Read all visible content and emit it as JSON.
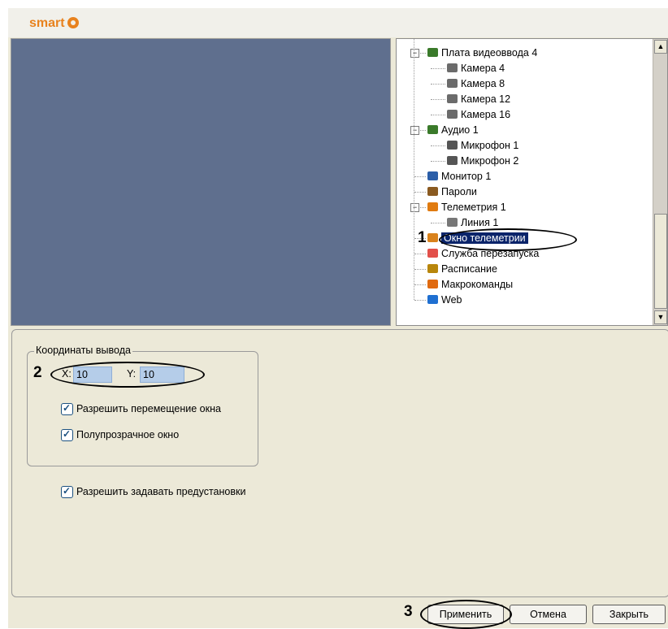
{
  "app": {
    "logo_text": "smart"
  },
  "tree": {
    "items": [
      {
        "label": "Плата видеоввода 4",
        "icon": "capture-card-icon",
        "level": 0,
        "expander": "⊟"
      },
      {
        "label": "Камера 4",
        "icon": "camera-icon",
        "level": 1
      },
      {
        "label": "Камера 8",
        "icon": "camera-icon",
        "level": 1
      },
      {
        "label": "Камера 12",
        "icon": "camera-icon",
        "level": 1
      },
      {
        "label": "Камера 16",
        "icon": "camera-icon",
        "level": 1
      },
      {
        "label": "Аудио 1",
        "icon": "audio-card-icon",
        "level": 0,
        "expander": "⊟"
      },
      {
        "label": "Микрофон 1",
        "icon": "microphone-icon",
        "level": 1
      },
      {
        "label": "Микрофон 2",
        "icon": "microphone-icon",
        "level": 1
      },
      {
        "label": "Монитор 1",
        "icon": "monitor-icon",
        "level": 0
      },
      {
        "label": "Пароли",
        "icon": "users-icon",
        "level": 0
      },
      {
        "label": "Телеметрия 1",
        "icon": "telemetry-icon",
        "level": 0,
        "expander": "⊟"
      },
      {
        "label": "Линия 1",
        "icon": "line-icon",
        "level": 1
      },
      {
        "label": "Окно телеметрии",
        "icon": "telemetry-window-icon",
        "level": 0,
        "selected": true
      },
      {
        "label": "Служба перезапуска",
        "icon": "restart-service-icon",
        "level": 0
      },
      {
        "label": "Расписание",
        "icon": "schedule-icon",
        "level": 0
      },
      {
        "label": "Макрокоманды",
        "icon": "macro-icon",
        "level": 0
      },
      {
        "label": "Web",
        "icon": "web-icon",
        "level": 0
      }
    ]
  },
  "settings": {
    "group_title": "Координаты вывода",
    "x_label": "X:",
    "x_value": "10",
    "y_label": "Y:",
    "y_value": "10",
    "allow_move_label": "Разрешить перемещение окна",
    "allow_move_checked": true,
    "translucent_label": "Полупрозрачное окно",
    "translucent_checked": true,
    "allow_presets_label": "Разрешить задавать предустановки",
    "allow_presets_checked": true
  },
  "buttons": {
    "apply": "Применить",
    "cancel": "Отмена",
    "close": "Закрыть"
  },
  "callouts": {
    "one": "1",
    "two": "2",
    "three": "3"
  },
  "colors": {
    "video_bg": "#5f6f8e",
    "selection": "#0a246a",
    "logo": "#e8821e",
    "field_bg": "#b5cde9"
  }
}
